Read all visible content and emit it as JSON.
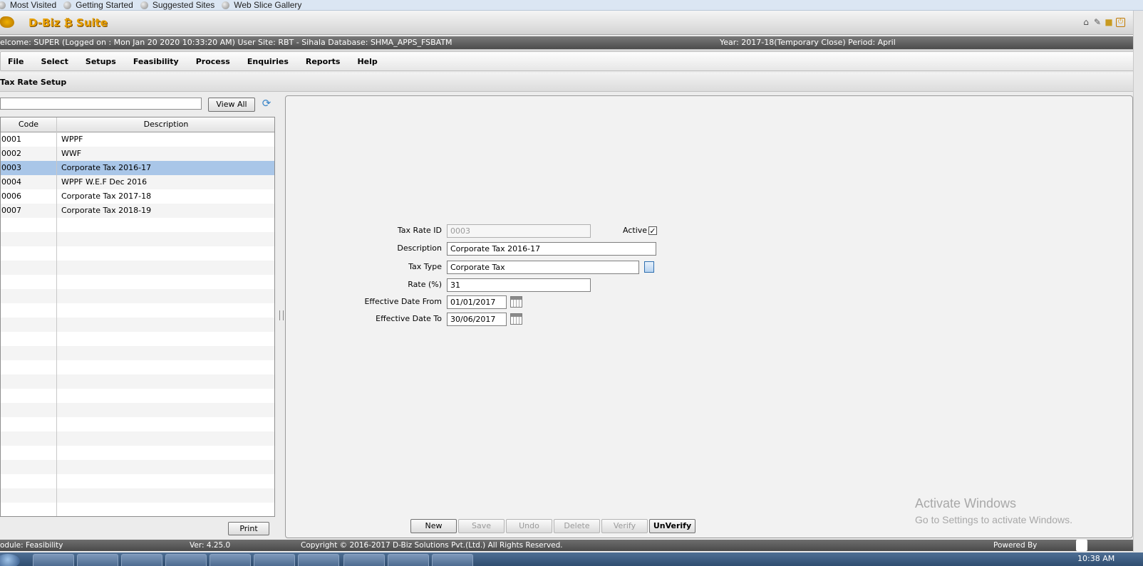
{
  "bookmarks": [
    "Most Visited",
    "Getting Started",
    "Suggested Sites",
    "Web Slice Gallery"
  ],
  "app": {
    "title": "D-Biz ₿ Suite"
  },
  "info": {
    "welcome": "elcome: SUPER (Logged on : Mon Jan 20 2020 10:33:20 AM) User Site: RBT - Sihala Database: SHMA_APPS_FSBATM",
    "year": "Year: 2017-18(Temporary Close) Period: April"
  },
  "menu": [
    "File",
    "Select",
    "Setups",
    "Feasibility",
    "Process",
    "Enquiries",
    "Reports",
    "Help"
  ],
  "page": {
    "title": "Tax Rate Setup"
  },
  "search": {
    "value": "",
    "view_all": "View All"
  },
  "grid": {
    "headers": {
      "code": "Code",
      "description": "Description"
    },
    "rows": [
      {
        "code": "0001",
        "description": "WPPF"
      },
      {
        "code": "0002",
        "description": "WWF"
      },
      {
        "code": "0003",
        "description": "Corporate Tax 2016-17",
        "selected": true
      },
      {
        "code": "0004",
        "description": "WPPF W.E.F Dec 2016"
      },
      {
        "code": "0006",
        "description": "Corporate Tax 2017-18"
      },
      {
        "code": "0007",
        "description": "Corporate Tax 2018-19"
      }
    ],
    "empty_rows": 21,
    "print": "Print"
  },
  "form": {
    "tax_rate_id": {
      "label": "Tax Rate ID",
      "value": "0003"
    },
    "active": {
      "label": "Active",
      "checked": true,
      "mark": "✓"
    },
    "description": {
      "label": "Description",
      "value": "Corporate Tax 2016-17"
    },
    "tax_type": {
      "label": "Tax Type",
      "value": "Corporate Tax"
    },
    "rate": {
      "label": "Rate (%)",
      "value": "31"
    },
    "eff_from": {
      "label": "Effective Date From",
      "value": "01/01/2017"
    },
    "eff_to": {
      "label": "Effective Date To",
      "value": "30/06/2017"
    }
  },
  "actions": {
    "new": "New",
    "save": "Save",
    "undo": "Undo",
    "delete": "Delete",
    "verify": "Verify",
    "unverify": "UnVerify"
  },
  "watermark": {
    "line1": "Activate Windows",
    "line2": "Go to Settings to activate Windows."
  },
  "status": {
    "module": "odule: Feasibility",
    "version": "Ver: 4.25.0",
    "copyright": "Copyright © 2016-2017 D-Biz Solutions Pvt.(Ltd.) All Rights Reserved.",
    "powered": "Powered By"
  },
  "clock": "10:38 AM",
  "colors": {
    "accent": "#e8a000",
    "selected_row": "#a9c6e8",
    "info_bar": "#5a5a5a"
  }
}
